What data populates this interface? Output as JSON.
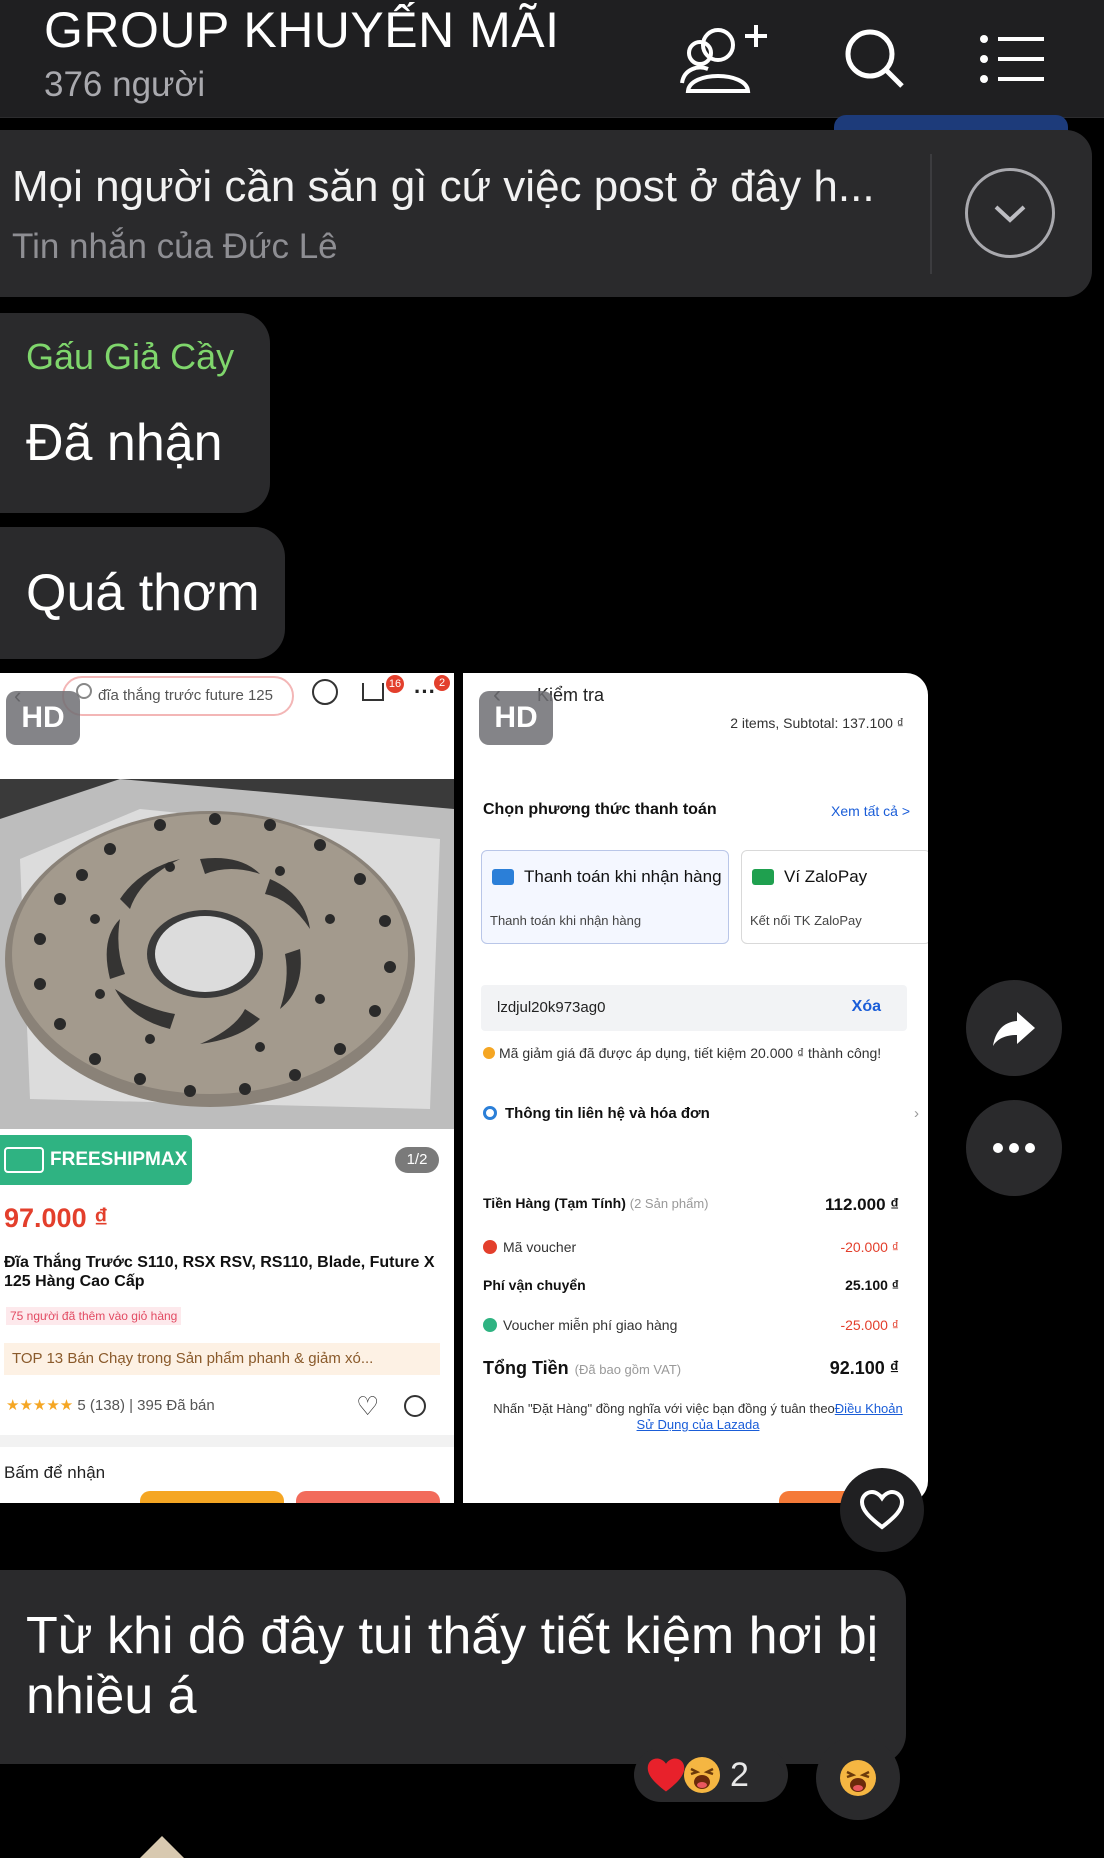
{
  "header": {
    "title": "GROUP KHUYẾN MÃI",
    "subtitle": "376 người",
    "icons": [
      "add-member-icon",
      "search-icon",
      "menu-icon"
    ]
  },
  "pinned": {
    "text": "Mọi người cần săn gì cứ việc post ở đây h...",
    "subtext": "Tin nhắn của Đức Lê"
  },
  "messages": [
    {
      "sender": "Gấu Giả Cầy",
      "text": "Đã nhận"
    },
    {
      "text": "Quá thơm"
    },
    {
      "text": "Từ khi dô đây tui thấy tiết kiệm hơi bị nhiều á"
    }
  ],
  "images": {
    "hd_label": "HD",
    "left": {
      "search": "đĩa thắng trước future 125",
      "cart_badge": "16",
      "more_badge": "2",
      "freeship": "FREESHIPMAX",
      "pager": "1/2",
      "price": "97.000 ₫",
      "product_name": "Đĩa Thắng Trước  S110, RSX RSV, RS110, Blade, Future X 125 Hàng Cao Cấp",
      "added_to_cart": "75 người đã thêm vào giỏ hàng",
      "top13": "TOP 13  Bán Chạy trong Sản phẩm phanh & giảm xó...",
      "rating": "5 (138)  |  395 Đã bán",
      "claim": "Bấm để nhận"
    },
    "right": {
      "title": "Kiểm tra",
      "subtotal_line": "2 items, Subtotal:  137.100 ₫",
      "payment_heading": "Chọn phương thức thanh toán",
      "see_all": "Xem tất cả >",
      "cod_title": "Thanh toán khi nhận hàng",
      "cod_sub": "Thanh toán khi nhận hàng",
      "zalopay_title": "Ví ZaloPay",
      "zalopay_sub": "Kết nối TK ZaloPay",
      "voucher_code": "lzdjul20k973ag0",
      "remove": "Xóa",
      "voucher_note": "Mã giảm giá đã được áp dụng, tiết kiệm 20.000 ₫ thành công!",
      "contact_info": "Thông tin liên hệ và hóa đơn",
      "rows": [
        {
          "label": "Tiền Hàng (Tạm Tính)",
          "sub": "(2 Sản phẩm)",
          "value": "112.000 ₫"
        },
        {
          "label": "Mã voucher",
          "value": "-20.000 ₫"
        },
        {
          "label": "Phí vận chuyển",
          "value": "25.100 ₫"
        },
        {
          "label": "Voucher miễn phí giao hàng",
          "value": "-25.000 ₫"
        }
      ],
      "total_label": "Tổng Tiền",
      "total_sub": "(Đã bao gồm VAT)",
      "total_value": "92.100 ₫",
      "legal_text": "Nhấn \"Đặt Hàng\" đồng nghĩa với việc bạn đồng ý tuân theo",
      "legal_link": "Điều Khoản Sử Dụng của Lazada"
    }
  },
  "reactions": {
    "emojis": [
      "heart",
      "laughing-face"
    ],
    "count": "2"
  },
  "colors": {
    "background": "#000000",
    "bubble": "#2a2a2c",
    "sender_name": "#7fd66c",
    "header": "#1f1f21"
  }
}
